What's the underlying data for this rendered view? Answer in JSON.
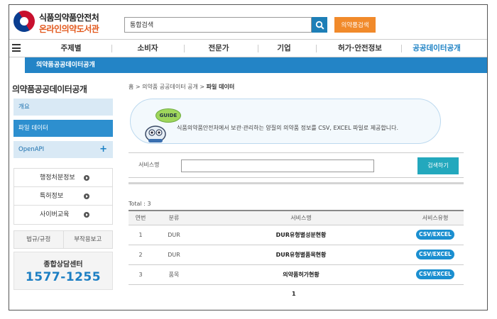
{
  "header": {
    "brand_line1": "식품의약품안전처",
    "brand_line2": "온라인의약도서관",
    "search_value": "통합검색",
    "drug_search_label": "의약품검색",
    "colors": {
      "brand_orange": "#e2581c",
      "accent_blue": "#1e7fb7",
      "orange_button": "#f18a2b"
    }
  },
  "nav": {
    "items": [
      "주제별",
      "소비자",
      "전문가",
      "기업",
      "허가·안전정보",
      "공공데이터공개"
    ],
    "active_index": 5
  },
  "subnav": {
    "label": "의약품공공데이터공개"
  },
  "sidebar": {
    "title": "의약품공공데이터공개",
    "menu": [
      "개요",
      "파일 데이터",
      "OpenAPI"
    ],
    "openapi_plus": "+",
    "sub_items": [
      "행정처분정보",
      "특허정보",
      "사이버교육"
    ],
    "law_label": "법규/규정",
    "side_effect_label": "부작용보고",
    "call_label": "종합상담센터",
    "call_number": "1577-1255"
  },
  "main": {
    "breadcrumb": [
      "홈",
      "의약품 공공데이터 공개",
      "파일 데이터"
    ],
    "guide_badge": "GUIDE",
    "guide_text": "식품의약품안전처에서 보관·관리하는 양질의 의약품 정보를 CSV, EXCEL 파일로 제공합니다.",
    "service_label": "서비스명",
    "service_input_value": "",
    "search_button": "검색하기",
    "total_text": "Total : 3",
    "table": {
      "headers": [
        "연번",
        "분류",
        "서비스명",
        "서비스유형"
      ],
      "rows": [
        {
          "no": "1",
          "category": "DUR",
          "name": "DUR유형별성분현황",
          "type": "CSV/EXCEL"
        },
        {
          "no": "2",
          "category": "DUR",
          "name": "DUR유형별품목현황",
          "type": "CSV/EXCEL"
        },
        {
          "no": "3",
          "category": "품목",
          "name": "의약품허가현황",
          "type": "CSV/EXCEL"
        }
      ]
    },
    "page": "1"
  }
}
